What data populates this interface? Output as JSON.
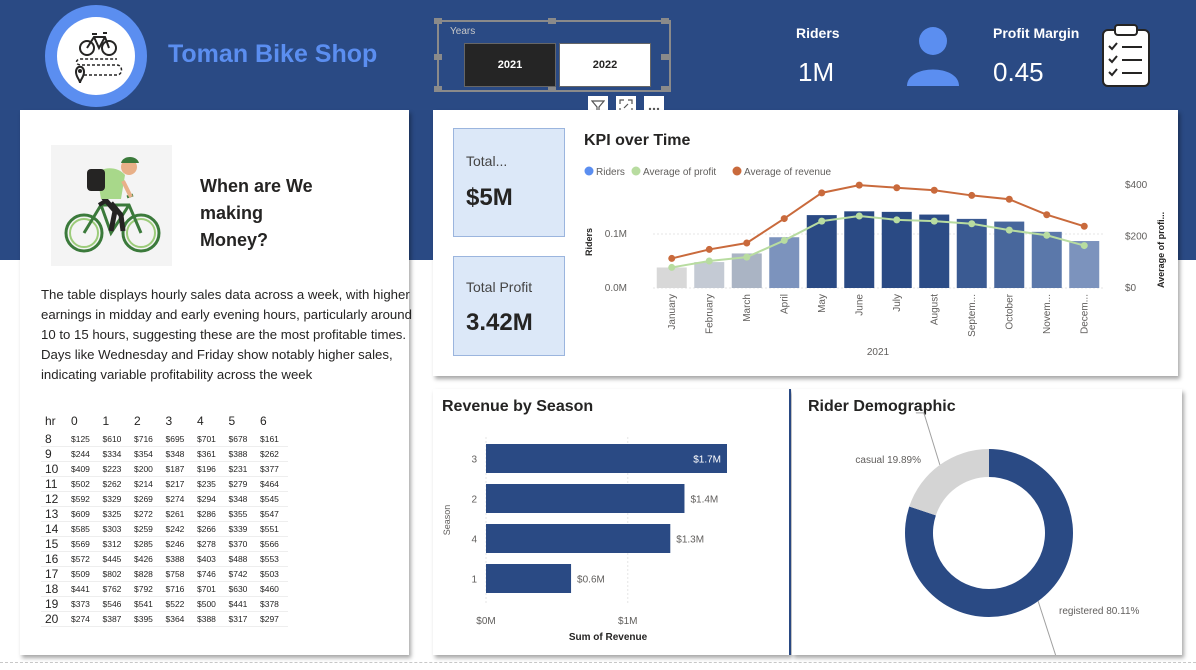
{
  "header": {
    "shop_title": "Toman Bike Shop",
    "years_label": "Years",
    "year_buttons": [
      "2021",
      "2022"
    ],
    "selected_year": "2021",
    "riders_label": "Riders",
    "riders_value": "1M",
    "profit_margin_label": "Profit Margin",
    "profit_margin_value": "0.45"
  },
  "left_panel": {
    "heading_lines": [
      "When are We",
      "making",
      "Money?"
    ],
    "description": "The table displays hourly sales data across a week, with higher earnings in midday and early evening hours, particularly around 10 to 15 hours, suggesting these are the most profitable times. Days like Wednesday and Friday show notably higher sales, indicating variable profitability across the week",
    "table_headers": [
      "hr",
      "0",
      "1",
      "2",
      "3",
      "4",
      "5",
      "6"
    ],
    "table_rows": [
      [
        "8",
        "$125",
        "$610",
        "$716",
        "$695",
        "$701",
        "$678",
        "$161"
      ],
      [
        "9",
        "$244",
        "$334",
        "$354",
        "$348",
        "$361",
        "$388",
        "$262"
      ],
      [
        "10",
        "$409",
        "$223",
        "$200",
        "$187",
        "$196",
        "$231",
        "$377"
      ],
      [
        "11",
        "$502",
        "$262",
        "$214",
        "$217",
        "$235",
        "$279",
        "$464"
      ],
      [
        "12",
        "$592",
        "$329",
        "$269",
        "$274",
        "$294",
        "$348",
        "$545"
      ],
      [
        "13",
        "$609",
        "$325",
        "$272",
        "$261",
        "$286",
        "$355",
        "$547"
      ],
      [
        "14",
        "$585",
        "$303",
        "$259",
        "$242",
        "$266",
        "$339",
        "$551"
      ],
      [
        "15",
        "$569",
        "$312",
        "$285",
        "$246",
        "$278",
        "$370",
        "$566"
      ],
      [
        "16",
        "$572",
        "$445",
        "$426",
        "$388",
        "$403",
        "$488",
        "$553"
      ],
      [
        "17",
        "$509",
        "$802",
        "$828",
        "$758",
        "$746",
        "$742",
        "$503"
      ],
      [
        "18",
        "$441",
        "$762",
        "$792",
        "$716",
        "$701",
        "$630",
        "$460"
      ],
      [
        "19",
        "$373",
        "$546",
        "$541",
        "$522",
        "$500",
        "$441",
        "$378"
      ],
      [
        "20",
        "$274",
        "$387",
        "$395",
        "$364",
        "$388",
        "$317",
        "$297"
      ]
    ]
  },
  "cards": {
    "total_revenue_label": "Total...",
    "total_revenue_value": "$5M",
    "total_profit_label": "Total Profit",
    "total_profit_value": "3.42M"
  },
  "chart_data": [
    {
      "type": "bar",
      "title": "KPI over Time",
      "legend": [
        "Riders",
        "Average of profit",
        "Average of revenue"
      ],
      "legend_colors": [
        "#5b8ef0",
        "#b8dca0",
        "#c96a3c"
      ],
      "categories": [
        "January",
        "February",
        "March",
        "April",
        "May",
        "June",
        "July",
        "August",
        "Septem...",
        "October",
        "Novem...",
        "Decem..."
      ],
      "xlabel": "2021",
      "ylabel": "Riders",
      "y2label": "Average of profi...",
      "y_ticks": [
        "0.0M",
        "0.1M"
      ],
      "y2_ticks": [
        "$0",
        "$200",
        "$400"
      ],
      "ylim": [
        0,
        0.2
      ],
      "y2lim": [
        0,
        420
      ],
      "series": [
        {
          "name": "Riders",
          "values": [
            0.038,
            0.048,
            0.064,
            0.094,
            0.135,
            0.142,
            0.141,
            0.136,
            0.128,
            0.123,
            0.104,
            0.087
          ]
        },
        {
          "name": "Average of profit",
          "values": [
            80,
            105,
            120,
            185,
            260,
            280,
            265,
            260,
            250,
            225,
            205,
            165
          ]
        },
        {
          "name": "Average of revenue",
          "values": [
            115,
            150,
            175,
            270,
            370,
            400,
            390,
            380,
            360,
            345,
            285,
            240
          ]
        }
      ],
      "bar_colors": [
        "#d8d8d8",
        "#c4cad4",
        "#aab4c4",
        "#7c93bd",
        "#2a4a84",
        "#2a4a84",
        "#2a4a84",
        "#2c4c86",
        "#3a5a92",
        "#48679c",
        "#5b78aa",
        "#7c93bd"
      ]
    },
    {
      "type": "bar",
      "title": "Revenue by Season",
      "orientation": "horizontal",
      "categories": [
        "3",
        "2",
        "4",
        "1"
      ],
      "values": [
        1.7,
        1.4,
        1.3,
        0.6
      ],
      "data_labels": [
        "$1.7M",
        "$1.4M",
        "$1.3M",
        "$0.6M"
      ],
      "x_ticks": [
        "$0M",
        "$1M"
      ],
      "xlim": [
        0,
        1.7
      ],
      "xlabel": "Sum of Revenue",
      "ylabel": "Season",
      "color": "#2a4a84"
    },
    {
      "type": "pie",
      "title": "Rider Demographic",
      "labels": [
        "registered",
        "casual"
      ],
      "values": [
        80.11,
        19.89
      ],
      "data_labels": [
        "registered 80.11%",
        "casual 19.89%"
      ],
      "colors": [
        "#2a4a84",
        "#d4d4d4"
      ]
    }
  ]
}
